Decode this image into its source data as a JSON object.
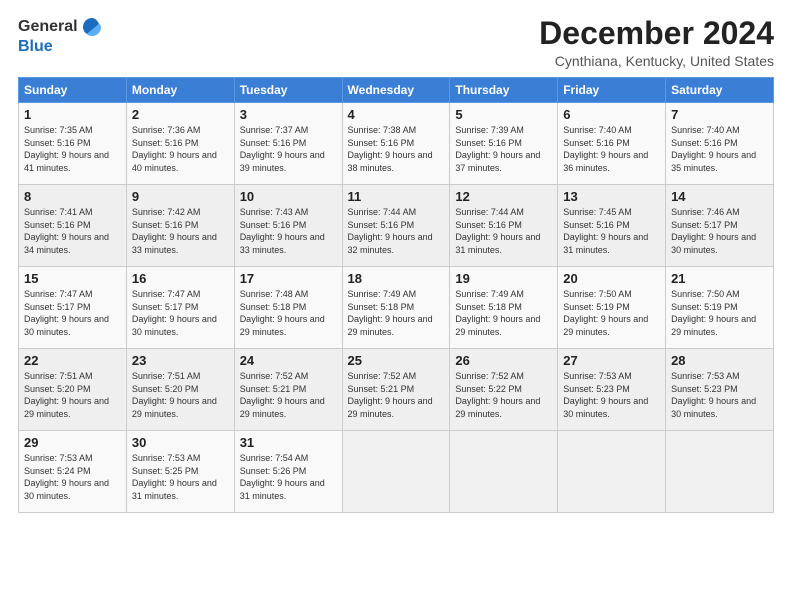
{
  "logo": {
    "general": "General",
    "blue": "Blue"
  },
  "title": "December 2024",
  "location": "Cynthiana, Kentucky, United States",
  "days_of_week": [
    "Sunday",
    "Monday",
    "Tuesday",
    "Wednesday",
    "Thursday",
    "Friday",
    "Saturday"
  ],
  "weeks": [
    [
      {
        "day": "1",
        "sunrise": "Sunrise: 7:35 AM",
        "sunset": "Sunset: 5:16 PM",
        "daylight": "Daylight: 9 hours and 41 minutes."
      },
      {
        "day": "2",
        "sunrise": "Sunrise: 7:36 AM",
        "sunset": "Sunset: 5:16 PM",
        "daylight": "Daylight: 9 hours and 40 minutes."
      },
      {
        "day": "3",
        "sunrise": "Sunrise: 7:37 AM",
        "sunset": "Sunset: 5:16 PM",
        "daylight": "Daylight: 9 hours and 39 minutes."
      },
      {
        "day": "4",
        "sunrise": "Sunrise: 7:38 AM",
        "sunset": "Sunset: 5:16 PM",
        "daylight": "Daylight: 9 hours and 38 minutes."
      },
      {
        "day": "5",
        "sunrise": "Sunrise: 7:39 AM",
        "sunset": "Sunset: 5:16 PM",
        "daylight": "Daylight: 9 hours and 37 minutes."
      },
      {
        "day": "6",
        "sunrise": "Sunrise: 7:40 AM",
        "sunset": "Sunset: 5:16 PM",
        "daylight": "Daylight: 9 hours and 36 minutes."
      },
      {
        "day": "7",
        "sunrise": "Sunrise: 7:40 AM",
        "sunset": "Sunset: 5:16 PM",
        "daylight": "Daylight: 9 hours and 35 minutes."
      }
    ],
    [
      {
        "day": "8",
        "sunrise": "Sunrise: 7:41 AM",
        "sunset": "Sunset: 5:16 PM",
        "daylight": "Daylight: 9 hours and 34 minutes."
      },
      {
        "day": "9",
        "sunrise": "Sunrise: 7:42 AM",
        "sunset": "Sunset: 5:16 PM",
        "daylight": "Daylight: 9 hours and 33 minutes."
      },
      {
        "day": "10",
        "sunrise": "Sunrise: 7:43 AM",
        "sunset": "Sunset: 5:16 PM",
        "daylight": "Daylight: 9 hours and 33 minutes."
      },
      {
        "day": "11",
        "sunrise": "Sunrise: 7:44 AM",
        "sunset": "Sunset: 5:16 PM",
        "daylight": "Daylight: 9 hours and 32 minutes."
      },
      {
        "day": "12",
        "sunrise": "Sunrise: 7:44 AM",
        "sunset": "Sunset: 5:16 PM",
        "daylight": "Daylight: 9 hours and 31 minutes."
      },
      {
        "day": "13",
        "sunrise": "Sunrise: 7:45 AM",
        "sunset": "Sunset: 5:16 PM",
        "daylight": "Daylight: 9 hours and 31 minutes."
      },
      {
        "day": "14",
        "sunrise": "Sunrise: 7:46 AM",
        "sunset": "Sunset: 5:17 PM",
        "daylight": "Daylight: 9 hours and 30 minutes."
      }
    ],
    [
      {
        "day": "15",
        "sunrise": "Sunrise: 7:47 AM",
        "sunset": "Sunset: 5:17 PM",
        "daylight": "Daylight: 9 hours and 30 minutes."
      },
      {
        "day": "16",
        "sunrise": "Sunrise: 7:47 AM",
        "sunset": "Sunset: 5:17 PM",
        "daylight": "Daylight: 9 hours and 30 minutes."
      },
      {
        "day": "17",
        "sunrise": "Sunrise: 7:48 AM",
        "sunset": "Sunset: 5:18 PM",
        "daylight": "Daylight: 9 hours and 29 minutes."
      },
      {
        "day": "18",
        "sunrise": "Sunrise: 7:49 AM",
        "sunset": "Sunset: 5:18 PM",
        "daylight": "Daylight: 9 hours and 29 minutes."
      },
      {
        "day": "19",
        "sunrise": "Sunrise: 7:49 AM",
        "sunset": "Sunset: 5:18 PM",
        "daylight": "Daylight: 9 hours and 29 minutes."
      },
      {
        "day": "20",
        "sunrise": "Sunrise: 7:50 AM",
        "sunset": "Sunset: 5:19 PM",
        "daylight": "Daylight: 9 hours and 29 minutes."
      },
      {
        "day": "21",
        "sunrise": "Sunrise: 7:50 AM",
        "sunset": "Sunset: 5:19 PM",
        "daylight": "Daylight: 9 hours and 29 minutes."
      }
    ],
    [
      {
        "day": "22",
        "sunrise": "Sunrise: 7:51 AM",
        "sunset": "Sunset: 5:20 PM",
        "daylight": "Daylight: 9 hours and 29 minutes."
      },
      {
        "day": "23",
        "sunrise": "Sunrise: 7:51 AM",
        "sunset": "Sunset: 5:20 PM",
        "daylight": "Daylight: 9 hours and 29 minutes."
      },
      {
        "day": "24",
        "sunrise": "Sunrise: 7:52 AM",
        "sunset": "Sunset: 5:21 PM",
        "daylight": "Daylight: 9 hours and 29 minutes."
      },
      {
        "day": "25",
        "sunrise": "Sunrise: 7:52 AM",
        "sunset": "Sunset: 5:21 PM",
        "daylight": "Daylight: 9 hours and 29 minutes."
      },
      {
        "day": "26",
        "sunrise": "Sunrise: 7:52 AM",
        "sunset": "Sunset: 5:22 PM",
        "daylight": "Daylight: 9 hours and 29 minutes."
      },
      {
        "day": "27",
        "sunrise": "Sunrise: 7:53 AM",
        "sunset": "Sunset: 5:23 PM",
        "daylight": "Daylight: 9 hours and 30 minutes."
      },
      {
        "day": "28",
        "sunrise": "Sunrise: 7:53 AM",
        "sunset": "Sunset: 5:23 PM",
        "daylight": "Daylight: 9 hours and 30 minutes."
      }
    ],
    [
      {
        "day": "29",
        "sunrise": "Sunrise: 7:53 AM",
        "sunset": "Sunset: 5:24 PM",
        "daylight": "Daylight: 9 hours and 30 minutes."
      },
      {
        "day": "30",
        "sunrise": "Sunrise: 7:53 AM",
        "sunset": "Sunset: 5:25 PM",
        "daylight": "Daylight: 9 hours and 31 minutes."
      },
      {
        "day": "31",
        "sunrise": "Sunrise: 7:54 AM",
        "sunset": "Sunset: 5:26 PM",
        "daylight": "Daylight: 9 hours and 31 minutes."
      },
      null,
      null,
      null,
      null
    ]
  ]
}
